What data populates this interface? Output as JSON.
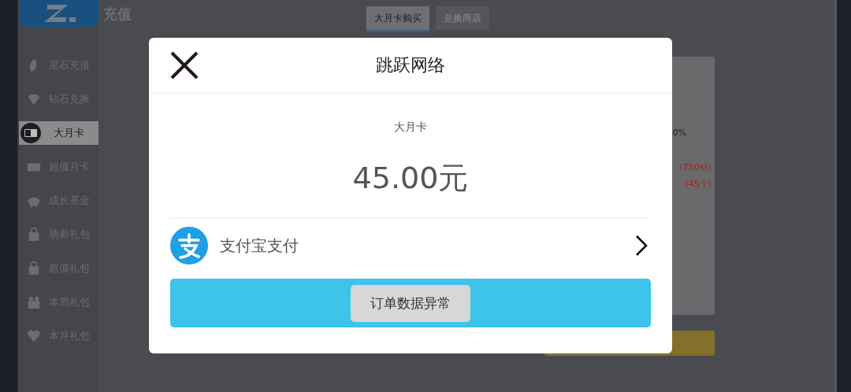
{
  "header": {
    "title": "充值"
  },
  "sidebar": {
    "items": [
      {
        "label": "星石充值",
        "kind": "leaf",
        "selected": false
      },
      {
        "label": "钻石兑换",
        "kind": "diamond",
        "selected": false
      },
      {
        "label": "大月卡",
        "kind": "card",
        "selected": true
      },
      {
        "label": "超值月卡",
        "kind": "ticket",
        "selected": false
      },
      {
        "label": "成长基金",
        "kind": "piggy",
        "selected": false
      },
      {
        "label": "萌新礼包",
        "kind": "bag",
        "selected": false
      },
      {
        "label": "超值礼包",
        "kind": "bag",
        "selected": false
      },
      {
        "label": "本周礼包",
        "kind": "gift",
        "selected": false
      },
      {
        "label": "本月礼包",
        "kind": "heart",
        "selected": false
      }
    ]
  },
  "tabs": [
    {
      "label": "大月卡购买",
      "selected": true
    },
    {
      "label": "兑换商店",
      "selected": false
    }
  ],
  "panel": {
    "texts": [
      "0%",
      "(750钻)",
      "(45个)"
    ]
  },
  "dialog": {
    "title": "跳跃网络",
    "product": "大月卡",
    "price": "45.00元",
    "payment_method": "支付宝支付"
  },
  "toast": "订单数据异常"
}
